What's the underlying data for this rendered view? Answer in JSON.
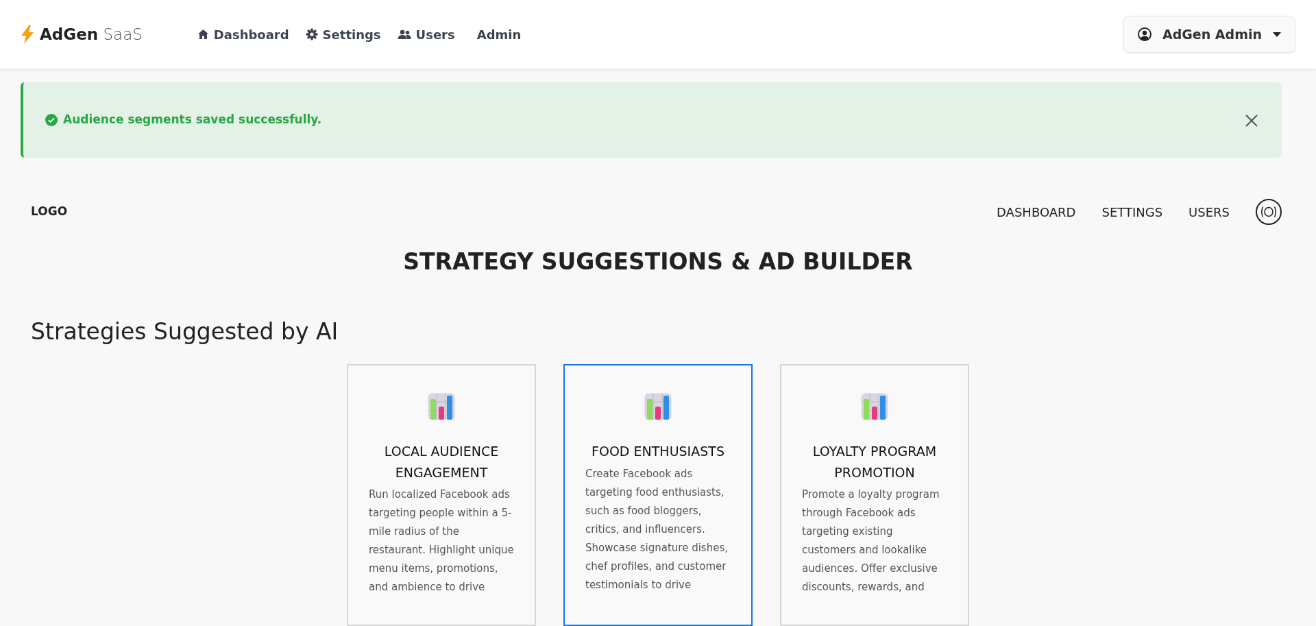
{
  "navbar": {
    "brand_bold": "AdGen",
    "brand_light": "SaaS",
    "links": [
      {
        "label": "Dashboard",
        "kind": "home"
      },
      {
        "label": "Settings",
        "kind": "gear"
      },
      {
        "label": "Users",
        "kind": "users"
      },
      {
        "label": "Admin",
        "kind": "plain"
      }
    ],
    "user_menu": {
      "label": "AdGen Admin"
    }
  },
  "alert": {
    "message": "Audience segments saved successfully.",
    "kind": "success"
  },
  "subheader": {
    "logo": "LOGO",
    "links": [
      "DASHBOARD",
      "SETTINGS",
      "USERS"
    ]
  },
  "page_title": "STRATEGY SUGGESTIONS & AD BUILDER",
  "section_title": "Strategies Suggested by AI",
  "cards": [
    {
      "title": "LOCAL AUDIENCE ENGAGEMENT",
      "text": "Run localized Facebook ads targeting people within a 5-mile radius of the restaurant. Highlight unique menu items, promotions, and ambience to drive",
      "selected": false
    },
    {
      "title": "FOOD ENTHUSIASTS",
      "text": "Create Facebook ads targeting food enthusiasts, such as food bloggers, critics, and influencers. Showcase signature dishes, chef profiles, and customer testimonials to drive",
      "selected": true
    },
    {
      "title": "LOYALTY PROGRAM PROMOTION",
      "text": "Promote a loyalty program through Facebook ads targeting existing customers and lookalike audiences. Offer exclusive discounts, rewards, and",
      "selected": false
    }
  ]
}
